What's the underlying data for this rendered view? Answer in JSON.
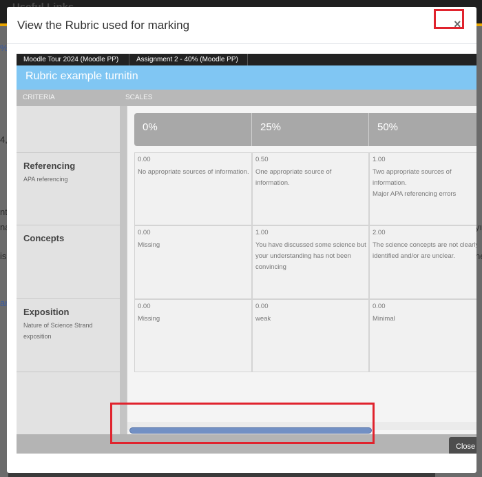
{
  "background": {
    "top_title": "Useful Links",
    "fragments": [
      "%",
      "4,",
      "nt",
      "na",
      "is",
      "ar",
      "yı",
      "ne"
    ]
  },
  "modal": {
    "title": "View the Rubric used for marking",
    "close_symbol": "×",
    "tabs": [
      "Moodle Tour 2024 (Moodle PP)",
      "Assignment 2 - 40% (Moodle PP)"
    ],
    "rubric_title": "Rubric example turnitin",
    "columns": {
      "criteria": "CRITERIA",
      "scales": "SCALES"
    },
    "scales": [
      "0%",
      "25%",
      "50%"
    ],
    "criteria": [
      {
        "name": "Referencing",
        "description": "APA referencing",
        "cells": [
          {
            "score": "0.00",
            "text": "No appropriate sources of information."
          },
          {
            "score": "0.50",
            "text": "One appropriate source of information."
          },
          {
            "score": "1.00",
            "text": "Two appropriate sources of information.\nMajor APA referencing errors"
          }
        ]
      },
      {
        "name": "Concepts",
        "description": "",
        "cells": [
          {
            "score": "0.00",
            "text": "Missing"
          },
          {
            "score": "1.00",
            "text": "You have discussed some science but your understanding has not been\nconvincing"
          },
          {
            "score": "2.00",
            "text": "The science concepts are not clearly identified and/or are unclear."
          }
        ]
      },
      {
        "name": "Exposition",
        "description": "Nature of Science Strand exposition",
        "cells": [
          {
            "score": "0.00",
            "text": "Missing"
          },
          {
            "score": "0.00",
            "text": "weak"
          },
          {
            "score": "0.00",
            "text": "Minimal"
          }
        ]
      }
    ],
    "close_button": "Close"
  },
  "colors": {
    "rubric_header": "#80c6f3",
    "highlight": "#e0232d",
    "scrollbar": "#7290c4"
  }
}
